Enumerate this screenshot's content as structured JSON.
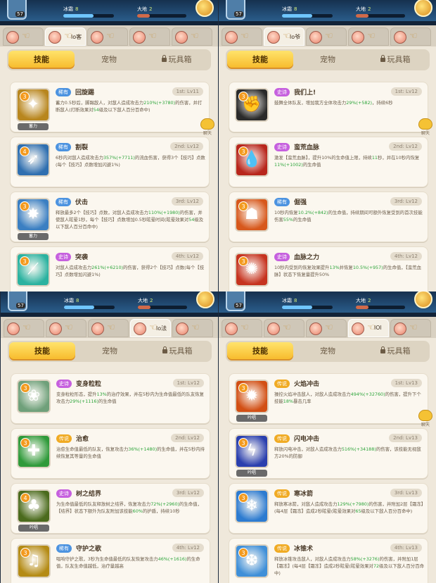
{
  "header": {
    "level": "57",
    "ice_label": "冰霜",
    "ice_value": "8",
    "earth_label": "大地",
    "earth_value": "2"
  },
  "common": {
    "main_tabs": [
      "技能",
      "宠物",
      "玩具箱"
    ],
    "chat_label": "聊天"
  },
  "panels": [
    {
      "hero_tabs": [
        "",
        "lo客",
        "",
        "",
        ""
      ],
      "active_hero_tab": 1,
      "cards": [
        {
          "rarity": "稀有",
          "rarity_type": "rare",
          "name": "回旋踢",
          "slot": "1st: Lv11",
          "stars": "3",
          "tag": "蓄力",
          "desc_parts": [
            "蓄力0.5秒后，脚踢敌人，对敌人造成攻击力",
            "210%",
            "(+3780)",
            "的伤害，并打断敌人(打断效果对",
            "54",
            "级及以下敌人百分百命中)"
          ],
          "icon_color": "#b8861e",
          "icon_glyph": "✦"
        },
        {
          "rarity": "稀有",
          "rarity_type": "rare",
          "name": "割裂",
          "slot": "2nd: Lv12",
          "stars": "4",
          "tag": "",
          "desc_parts": [
            "6秒内对敌人造成攻击力",
            "357%",
            "(+7711)",
            "的流血伤害，获得3个【技巧】点数(每个【技巧】点数增加闪避1%)",
            "",
            ""
          ],
          "icon_color": "#2f6fb0",
          "icon_glyph": "➶"
        },
        {
          "rarity": "稀有",
          "rarity_type": "rare",
          "name": "伏击",
          "slot": "3rd: Lv12",
          "stars": "3",
          "tag": "蓄力",
          "desc_parts": [
            "释放最多2个【技巧】点数，对敌人造成攻击力",
            "110%",
            "(+1980)",
            "的伤害，并使敌人眩晕1秒，每个【技巧】点数增加0.5秒眩晕时间(眩晕效果对",
            "54",
            "级及以下敌人百分百命中)"
          ],
          "icon_color": "#3b7fc2",
          "icon_glyph": "✸"
        },
        {
          "rarity": "史诗",
          "rarity_type": "epic",
          "name": "突袭",
          "slot": "4th: Lv12",
          "stars": "3",
          "tag": "",
          "desc_parts": [
            "对敌人造成攻击力",
            "261%",
            "(+6210)",
            "的伤害，获得2个【技巧】点数(每个【技巧】点数增加闪避1%)",
            "",
            ""
          ],
          "icon_color": "#2bb2a0",
          "icon_glyph": "⟋"
        }
      ]
    },
    {
      "hero_tabs": [
        "",
        "lo爷",
        "",
        "",
        ""
      ],
      "active_hero_tab": 1,
      "cards": [
        {
          "rarity": "史诗",
          "rarity_type": "epic",
          "name": "我们上!",
          "slot": "1st: Lv12",
          "stars": "3",
          "tag": "",
          "desc_parts": [
            "鼓舞全体队友，增加我方全体攻击力",
            "29%",
            "(+582)",
            "，持续6秒",
            "",
            ""
          ],
          "icon_color": "#2a2a2a",
          "icon_glyph": "✊"
        },
        {
          "rarity": "史诗",
          "rarity_type": "epic",
          "name": "蛮荒血脉",
          "slot": "2nd: Lv12",
          "stars": "3",
          "tag": "",
          "desc_parts": [
            "激发【蛮荒血脉】，提升10%的生命值上限，持续",
            "11",
            "秒，并在10秒内恢复",
            "11%",
            "(+1002)",
            "的生命值"
          ],
          "icon_color": "#b8261c",
          "icon_glyph": "💧"
        },
        {
          "rarity": "稀有",
          "rarity_type": "rare",
          "name": "倔强",
          "slot": "3rd: Lv12",
          "stars": "3",
          "tag": "",
          "desc_parts": [
            "10秒内恢复",
            "10.2%",
            "(+842)",
            "的生命值，持续期间可额外恢复受到的首次技能伤害",
            "55%",
            "的生命值"
          ],
          "icon_color": "#d7581c",
          "icon_glyph": "☗"
        },
        {
          "rarity": "史诗",
          "rarity_type": "epic",
          "name": "血脉之力",
          "slot": "4th: Lv12",
          "stars": "3",
          "tag": "",
          "desc_parts": [
            "10秒内受到的恢复效果提升",
            "13%",
            "并恢复",
            "10.5%",
            "(+957)",
            "的生命值，【蛮荒血脉】状态下恢复量提升50%"
          ],
          "icon_color": "#c6331f",
          "icon_glyph": "✺"
        }
      ]
    },
    {
      "hero_tabs": [
        "",
        "",
        "",
        "lo法",
        ""
      ],
      "active_hero_tab": 3,
      "cards": [
        {
          "rarity": "史诗",
          "rarity_type": "epic",
          "name": "变身粒粒",
          "slot": "1st: Lv12",
          "stars": "3",
          "tag": "",
          "desc_parts": [
            "变身粒粒形态，提升",
            "13%",
            "的治疗效果，并在5秒内为生命值最低的队友恢复攻击力",
            "29%",
            "(+1116)",
            "的生命值"
          ],
          "icon_color": "#6fa07a",
          "icon_glyph": "❀"
        },
        {
          "rarity": "传说",
          "rarity_type": "legend",
          "name": "治愈",
          "slot": "2nd: Lv12",
          "stars": "3",
          "tag": "",
          "desc_parts": [
            "治愈生命值最低的队友，恢复攻击力",
            "36%",
            "(+1480)",
            "的生命值，并在5秒内持续恢复其等量的生命值",
            "",
            ""
          ],
          "icon_color": "#2f9a3a",
          "icon_glyph": "✚"
        },
        {
          "rarity": "史诗",
          "rarity_type": "epic",
          "name": "树之结界",
          "slot": "3rd: Lv12",
          "stars": "4",
          "tag": "吟唱",
          "desc_parts": [
            "为生命值最低的队友释放树之结界，恢复攻击力",
            "72%",
            "(+2960)",
            "的生命值，【结界】状态下额外为队友附加该技能",
            "60%",
            "的护盾，持续10秒"
          ],
          "icon_color": "#4b6b1d",
          "icon_glyph": "♣"
        },
        {
          "rarity": "稀有",
          "rarity_type": "rare",
          "name": "守护之歌",
          "slot": "4th: Lv12",
          "stars": "3",
          "tag": "",
          "desc_parts": [
            "唱响守护之歌，3秒为生命值最低的队友恢复攻击力",
            "46%",
            "(+1616)",
            "的生命值，队友生命值越低，治疗量越高",
            "",
            ""
          ],
          "icon_color": "#b48b15",
          "icon_glyph": "♫"
        }
      ]
    },
    {
      "hero_tabs": [
        "",
        "",
        "",
        "lOl",
        ""
      ],
      "active_hero_tab": 3,
      "cards": [
        {
          "rarity": "传说",
          "rarity_type": "legend",
          "name": "火焰冲击",
          "slot": "1st: Lv13",
          "stars": "3",
          "tag": "吟唱",
          "desc_parts": [
            "操控火焰冲击敌人，对敌人造成攻击力",
            "494%",
            "(+32760)",
            "的伤害，提升下个技能",
            "18%",
            "暴击几率"
          ],
          "icon_color": "#d24f14",
          "icon_glyph": "✹"
        },
        {
          "rarity": "传说",
          "rarity_type": "legend",
          "name": "闪电冲击",
          "slot": "2nd: Lv13",
          "stars": "3",
          "tag": "吟唱",
          "desc_parts": [
            "释放闪电冲击，对敌人造成攻击力",
            "516%",
            "(+34188)",
            "的伤害，该技能无视敌方20%的防御",
            "",
            ""
          ],
          "icon_color": "#2a3fae",
          "icon_glyph": "ϟ"
        },
        {
          "rarity": "传说",
          "rarity_type": "legend",
          "name": "寒冰箭",
          "slot": "3rd: Lv13",
          "stars": "3",
          "tag": "",
          "desc_parts": [
            "释放寒冰箭，对敌人造成攻击力",
            "129%",
            "(+7980)",
            "的伤害，并附加2层【霜冻】(每4层【霜冻】造成2秒眩晕(眩晕效果对",
            "65",
            "级及以下敌人百分百命中)"
          ],
          "icon_color": "#2d7bd0",
          "icon_glyph": "❄"
        },
        {
          "rarity": "传说",
          "rarity_type": "legend",
          "name": "冰锥术",
          "slot": "4th: Lv13",
          "stars": "3",
          "tag": "",
          "desc_parts": [
            "释放冰锥攻击敌人，对敌人造成攻击力",
            "58%",
            "(+3276)",
            "的伤害，并附加1层【霜冻】(每4层【霜冻】造成2秒眩晕(眩晕效果对",
            "72",
            "级及以下敌人百分百命中)"
          ],
          "icon_color": "#3f8fd8",
          "icon_glyph": "❆"
        }
      ]
    }
  ]
}
